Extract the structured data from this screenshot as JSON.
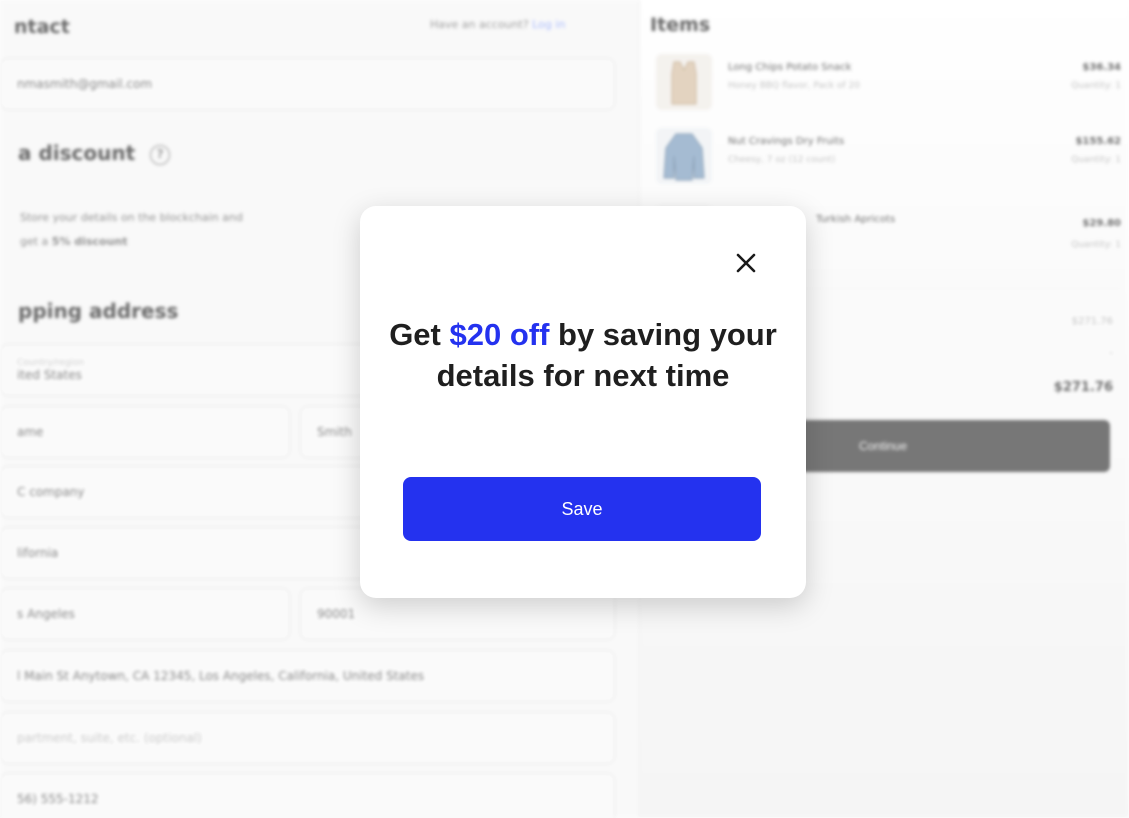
{
  "contact": {
    "title": "ntact",
    "login_prompt": "Have an account?",
    "login_link": "Log in",
    "email_value": "nmasmith@gmail.com"
  },
  "discount": {
    "title": "a discount",
    "help_icon": "help-circle-icon",
    "text_line1": "Store your details on the blockchain and",
    "text_line2_prefix": "get a ",
    "text_line2_bold": "5% discount"
  },
  "shipping": {
    "title": "pping address",
    "country_label": "Country/region",
    "country_value": "ited States",
    "last_name": "Smith",
    "first_name": "ame",
    "company": "C company",
    "state": "lifornia",
    "city": "s Angeles",
    "zip": "90001",
    "address": "l Main St Anytown, CA 12345, Los Angeles, California, United States",
    "apartment_placeholder": "partment, suite, etc. (optional)",
    "phone": "56) 555-1212"
  },
  "items": {
    "title": "Items",
    "list": [
      {
        "name": "Long Chips Potato Snack",
        "sub": "Honey BBQ flavor, Pack of 20",
        "price": "$36.34",
        "qty": "Quantity: 1",
        "thumb": "vest-thumbnail"
      },
      {
        "name": "Nut Cravings Dry Fruits",
        "sub": "Cheesy, 7 oz (12 count)",
        "price": "$155.62",
        "qty": "Quantity: 1",
        "thumb": "denim-jacket-thumbnail"
      },
      {
        "name": "Turkish Apricots",
        "sub": "",
        "price": "$29.80",
        "qty": "Quantity: 1",
        "thumb": "item-thumbnail"
      }
    ],
    "subtotal": "$271.76",
    "shipping": "-",
    "total": "$271.76",
    "continue_label": "Continue"
  },
  "modal": {
    "headline_before": "Get ",
    "headline_highlight": "$20 off",
    "headline_after": " by saving your details for next time",
    "save_label": "Save",
    "close_icon": "close-icon",
    "accent_color": "#2432ef"
  }
}
